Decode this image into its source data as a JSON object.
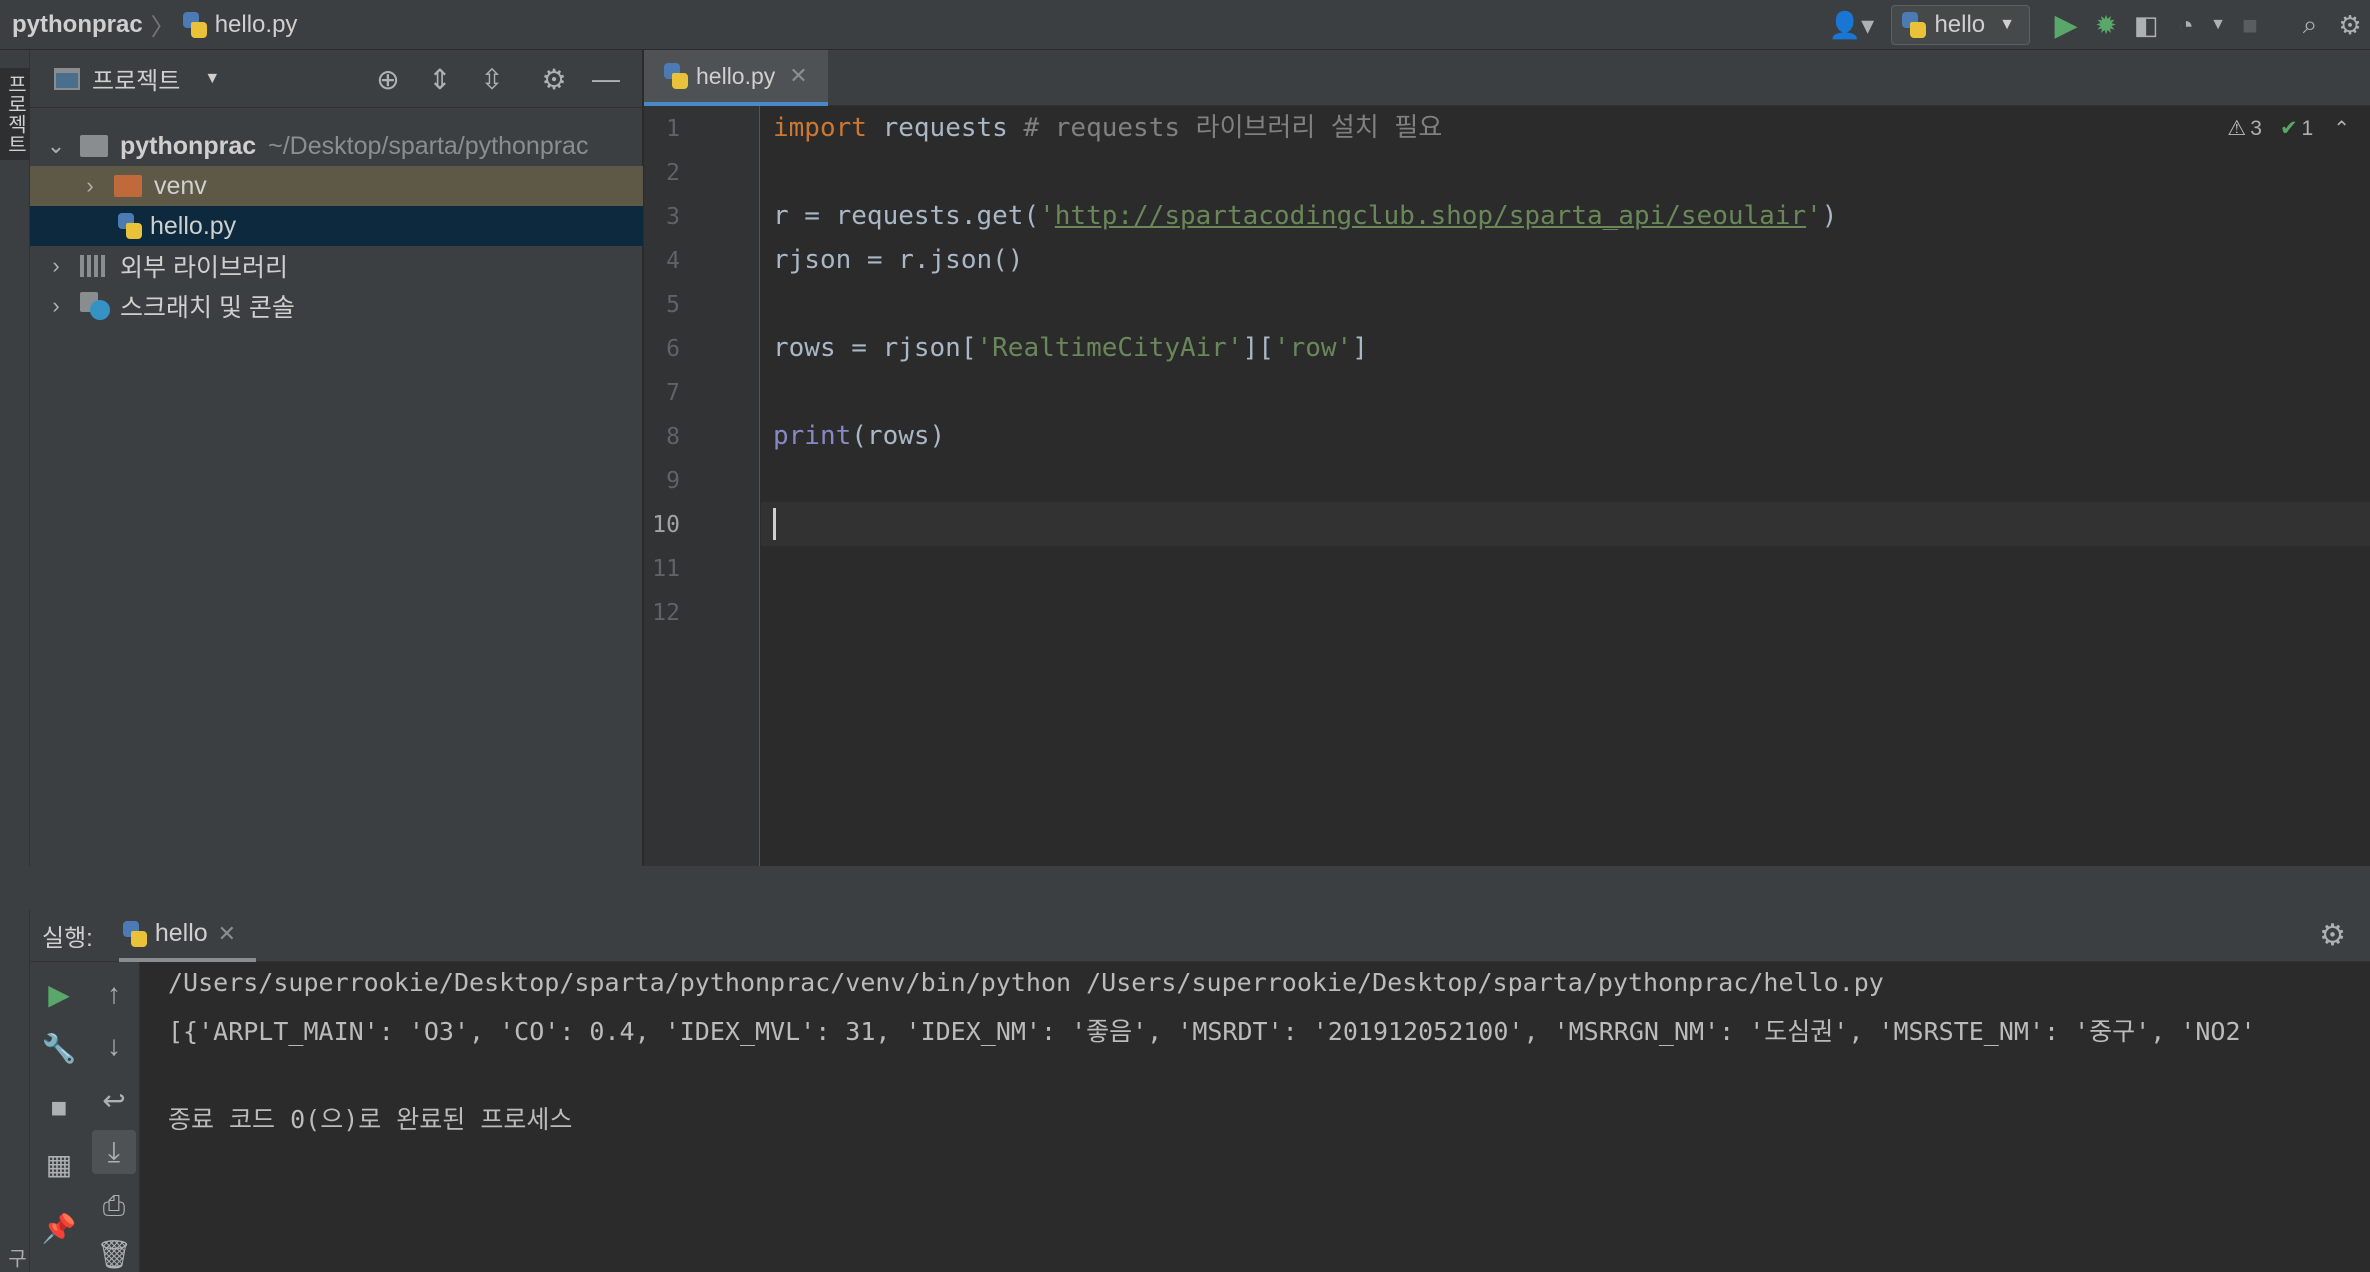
{
  "breadcrumb": {
    "project": "pythonprac",
    "file": "hello.py"
  },
  "run_config": {
    "name": "hello"
  },
  "left_stripe": {
    "project_label": "프로젝트",
    "structure_label": "구조"
  },
  "project_panel": {
    "title": "프로젝트",
    "tree": [
      {
        "name": "pythonprac",
        "hint": "~/Desktop/sparta/pythonprac"
      },
      {
        "name": "venv"
      },
      {
        "name": "hello.py"
      },
      {
        "name": "외부 라이브러리"
      },
      {
        "name": "스크래치 및 콘솔"
      }
    ]
  },
  "editor": {
    "tab": "hello.py",
    "line_numbers": [
      "1",
      "2",
      "3",
      "4",
      "5",
      "6",
      "7",
      "8",
      "9",
      "10",
      "11",
      "12"
    ],
    "current_line": "10",
    "inspections": {
      "warnings": "3",
      "ok": "1"
    },
    "code": {
      "l1_kw": "import",
      "l1_rest": " requests ",
      "l1_cmt": "# requests 라이브러리 설치 필요",
      "l3_pre": "r = requests.get(",
      "l3_q1": "'",
      "l3_url": "http://spartacodingclub.shop/sparta_api/seoulair",
      "l3_q2": "'",
      "l3_post": ")",
      "l4": "rjson = r.json()",
      "l6_pre": "rows = rjson[",
      "l6_s1": "'RealtimeCityAir'",
      "l6_mid": "][",
      "l6_s2": "'row'",
      "l6_post": "]",
      "l8_fn": "print",
      "l8_rest": "(rows)"
    }
  },
  "run_panel": {
    "label": "실행:",
    "tab": "hello",
    "console": [
      "/Users/superrookie/Desktop/sparta/pythonprac/venv/bin/python /Users/superrookie/Desktop/sparta/pythonprac/hello.py",
      "[{'ARPLT_MAIN': 'O3', 'CO': 0.4, 'IDEX_MVL': 31, 'IDEX_NM': '좋음', 'MSRDT': '201912052100', 'MSRRGN_NM': '도심권', 'MSRSTE_NM': '중구', 'NO2'",
      "",
      "종료 코드 0(으)로 완료된 프로세스"
    ]
  }
}
